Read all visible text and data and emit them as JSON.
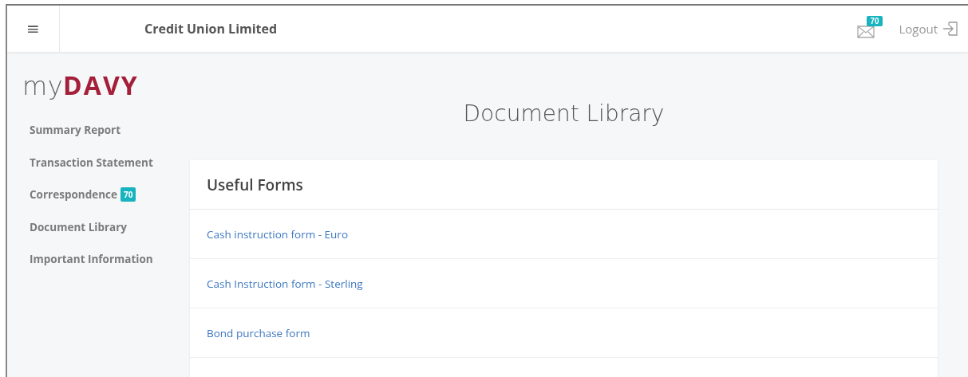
{
  "header": {
    "menu_icon": "≡",
    "title": "Credit Union Limited",
    "mail_badge": "70",
    "logout": "Logout"
  },
  "logo": {
    "prefix": "my",
    "brand": "DAVY"
  },
  "sidebar": {
    "items": [
      {
        "label": "Summary Report"
      },
      {
        "label": "Transaction Statement"
      },
      {
        "label": "Correspondence",
        "badge": "70"
      },
      {
        "label": "Document Library"
      },
      {
        "label": "Important Information"
      }
    ]
  },
  "page_title": "Document Library",
  "card": {
    "title": "Useful Forms",
    "links": [
      "Cash instruction form - Euro",
      "Cash Instruction form - Sterling",
      "Bond purchase form"
    ]
  }
}
